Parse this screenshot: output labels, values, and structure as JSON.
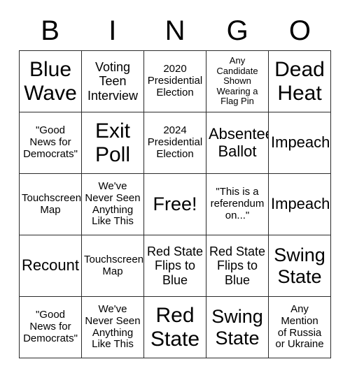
{
  "card": {
    "header_letters": [
      "B",
      "I",
      "N",
      "G",
      "O"
    ],
    "rows": [
      [
        {
          "text": "Blue\nWave",
          "size": "fs-xxl"
        },
        {
          "text": "Voting\nTeen\nInterview",
          "size": "fs-md"
        },
        {
          "text": "2020\nPresidential\nElection",
          "size": "fs-sm"
        },
        {
          "text": "Any\nCandidate\nShown\nWearing a\nFlag Pin",
          "size": "fs-xs"
        },
        {
          "text": "Dead\nHeat",
          "size": "fs-xxl"
        }
      ],
      [
        {
          "text": "\"Good\nNews for\nDemocrats\"",
          "size": "fs-sm"
        },
        {
          "text": "Exit\nPoll",
          "size": "fs-xxl"
        },
        {
          "text": "2024\nPresidential\nElection",
          "size": "fs-sm"
        },
        {
          "text": "Absentee\nBallot",
          "size": "fs-lg"
        },
        {
          "text": "Impeach",
          "size": "fs-lg"
        }
      ],
      [
        {
          "text": "Touchscreen\nMap",
          "size": "fs-sm"
        },
        {
          "text": "We've\nNever Seen\nAnything\nLike This",
          "size": "fs-sm"
        },
        {
          "text": "Free!",
          "size": "fs-xl"
        },
        {
          "text": "\"This is a\nreferendum\non...\"",
          "size": "fs-sm"
        },
        {
          "text": "Impeach",
          "size": "fs-lg"
        }
      ],
      [
        {
          "text": "Recount",
          "size": "fs-lg"
        },
        {
          "text": "Touchscreen\nMap",
          "size": "fs-sm"
        },
        {
          "text": "Red State\nFlips to\nBlue",
          "size": "fs-md"
        },
        {
          "text": "Red State\nFlips to\nBlue",
          "size": "fs-md"
        },
        {
          "text": "Swing\nState",
          "size": "fs-xl"
        }
      ],
      [
        {
          "text": "\"Good\nNews for\nDemocrats\"",
          "size": "fs-sm"
        },
        {
          "text": "We've\nNever Seen\nAnything\nLike This",
          "size": "fs-sm"
        },
        {
          "text": "Red\nState",
          "size": "fs-xxl"
        },
        {
          "text": "Swing\nState",
          "size": "fs-xl"
        },
        {
          "text": "Any\nMention\nof Russia\nor Ukraine",
          "size": "fs-sm"
        }
      ]
    ],
    "colors": {
      "background": "#ffffff",
      "text": "#000000",
      "grid_line": "#2b2b2b"
    }
  }
}
